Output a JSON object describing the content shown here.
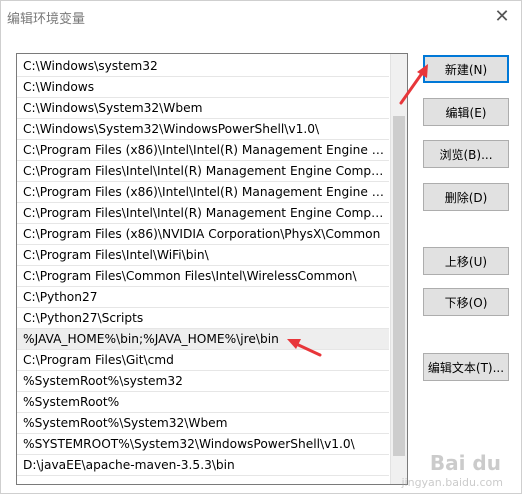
{
  "window": {
    "title": "编辑环境变量"
  },
  "paths": [
    "C:\\Windows\\system32",
    "C:\\Windows",
    "C:\\Windows\\System32\\Wbem",
    "C:\\Windows\\System32\\WindowsPowerShell\\v1.0\\",
    "C:\\Program Files (x86)\\Intel\\Intel(R) Management Engine Co...",
    "C:\\Program Files\\Intel\\Intel(R) Management Engine Compon...",
    "C:\\Program Files (x86)\\Intel\\Intel(R) Management Engine Co...",
    "C:\\Program Files\\Intel\\Intel(R) Management Engine Compon...",
    "C:\\Program Files (x86)\\NVIDIA Corporation\\PhysX\\Common",
    "C:\\Program Files\\Intel\\WiFi\\bin\\",
    "C:\\Program Files\\Common Files\\Intel\\WirelessCommon\\",
    "C:\\Python27",
    "C:\\Python27\\Scripts",
    "%JAVA_HOME%\\bin;%JAVA_HOME%\\jre\\bin",
    "C:\\Program Files\\Git\\cmd",
    "%SystemRoot%\\system32",
    "%SystemRoot%",
    "%SystemRoot%\\System32\\Wbem",
    "%SYSTEMROOT%\\System32\\WindowsPowerShell\\v1.0\\",
    "D:\\javaEE\\apache-maven-3.5.3\\bin"
  ],
  "buttons": {
    "new": "新建(N)",
    "edit": "编辑(E)",
    "browse": "浏览(B)...",
    "delete": "删除(D)",
    "move_up": "上移(U)",
    "move_down": "下移(O)",
    "edit_text": "编辑文本(T)..."
  },
  "watermark": {
    "brand": "Bai du",
    "sub": "jingyan.baidu.com"
  },
  "colors": {
    "annotation_arrow": "#e8363a",
    "focus_border": "#0078d7"
  }
}
